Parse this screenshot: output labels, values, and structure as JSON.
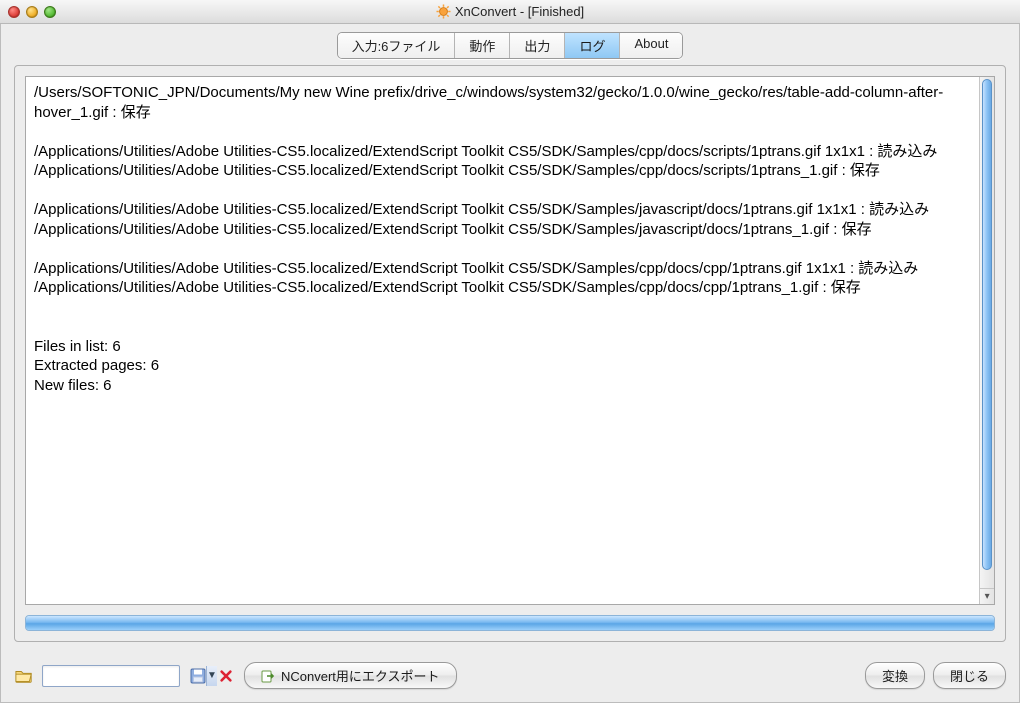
{
  "window": {
    "title": "XnConvert - [Finished]"
  },
  "tabs": {
    "input": "入力:6ファイル",
    "action": "動作",
    "output": "出力",
    "log": "ログ",
    "about": "About"
  },
  "log_text": "/Users/SOFTONIC_JPN/Documents/My new Wine prefix/drive_c/windows/system32/gecko/1.0.0/wine_gecko/res/table-add-column-after-hover_1.gif : 保存\n\n/Applications/Utilities/Adobe Utilities-CS5.localized/ExtendScript Toolkit CS5/SDK/Samples/cpp/docs/scripts/1ptrans.gif 1x1x1 : 読み込み\n/Applications/Utilities/Adobe Utilities-CS5.localized/ExtendScript Toolkit CS5/SDK/Samples/cpp/docs/scripts/1ptrans_1.gif : 保存\n\n/Applications/Utilities/Adobe Utilities-CS5.localized/ExtendScript Toolkit CS5/SDK/Samples/javascript/docs/1ptrans.gif 1x1x1 : 読み込み\n/Applications/Utilities/Adobe Utilities-CS5.localized/ExtendScript Toolkit CS5/SDK/Samples/javascript/docs/1ptrans_1.gif : 保存\n\n/Applications/Utilities/Adobe Utilities-CS5.localized/ExtendScript Toolkit CS5/SDK/Samples/cpp/docs/cpp/1ptrans.gif 1x1x1 : 読み込み\n/Applications/Utilities/Adobe Utilities-CS5.localized/ExtendScript Toolkit CS5/SDK/Samples/cpp/docs/cpp/1ptrans_1.gif : 保存\n\n\nFiles in list: 6\nExtracted pages: 6\nNew files: 6\n",
  "bottom": {
    "combo_value": "",
    "export_label": "NConvert用にエクスポート",
    "convert_label": "変換",
    "close_label": "閉じる"
  }
}
